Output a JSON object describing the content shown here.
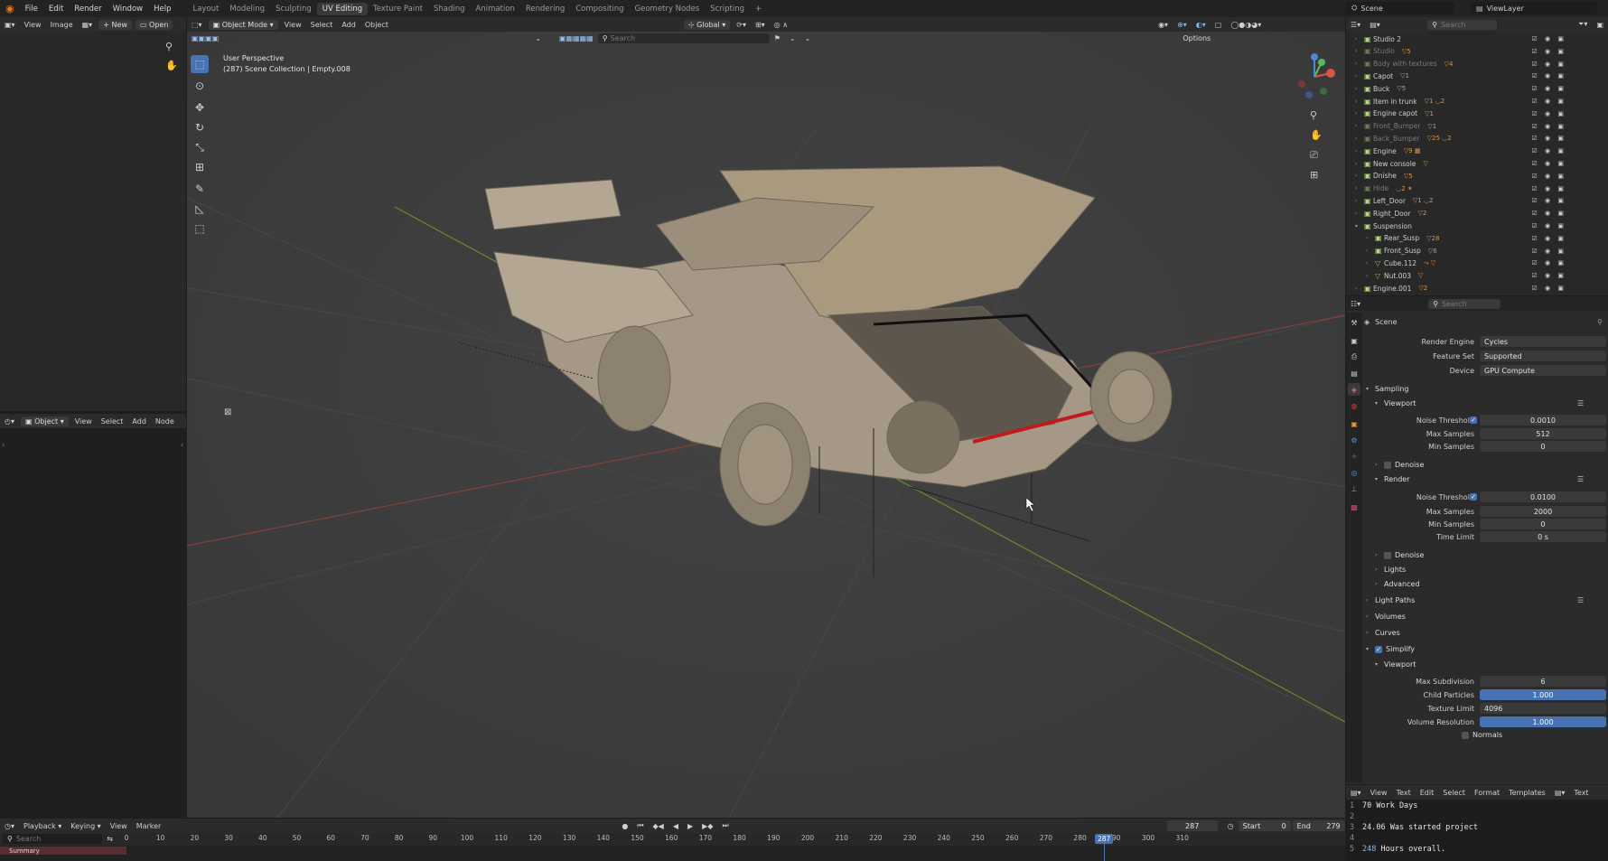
{
  "topbar": {
    "menus": [
      "File",
      "Edit",
      "Render",
      "Window",
      "Help"
    ],
    "workspaces": [
      "Layout",
      "Modeling",
      "Sculpting",
      "UV Editing",
      "Texture Paint",
      "Shading",
      "Animation",
      "Rendering",
      "Compositing",
      "Geometry Nodes",
      "Scripting"
    ],
    "active_workspace": "UV Editing",
    "scene_name": "Scene",
    "view_layer": "ViewLayer"
  },
  "image_editor": {
    "menus": [
      "View",
      "Image"
    ],
    "new_label": "New",
    "open_label": "Open"
  },
  "node_editor": {
    "mode": "Object",
    "menus": [
      "View",
      "Select",
      "Add",
      "Node"
    ]
  },
  "viewport": {
    "mode": "Object Mode",
    "menus": [
      "View",
      "Select",
      "Add",
      "Object"
    ],
    "orientation": "Global",
    "search_placeholder": "Search",
    "options_label": "Options",
    "info_line1": "User Perspective",
    "info_line2": "(287) Scene Collection | Empty.008"
  },
  "outliner": {
    "search_placeholder": "Search",
    "items": [
      {
        "name": "Studio 2",
        "badges": "",
        "muted": false,
        "indent": 0
      },
      {
        "name": "Studio",
        "badges": "▽5",
        "muted": true,
        "indent": 0
      },
      {
        "name": "Body with textures",
        "badges": "▽4",
        "muted": true,
        "indent": 0
      },
      {
        "name": "Capot",
        "badges": "▽1",
        "muted": false,
        "indent": 0
      },
      {
        "name": "Buck",
        "badges": "▽5",
        "muted": false,
        "indent": 0
      },
      {
        "name": "Item in trunk",
        "badges": "▽1 ◡2",
        "muted": false,
        "indent": 0
      },
      {
        "name": "Engine capot",
        "badges": "▽1",
        "muted": false,
        "indent": 0
      },
      {
        "name": "Front_Bumper",
        "badges": "▽1",
        "muted": true,
        "indent": 0
      },
      {
        "name": "Back_Bumper",
        "badges": "▽25 ◡2",
        "muted": true,
        "indent": 0
      },
      {
        "name": "Engine",
        "badges": "▽9 ▦",
        "muted": false,
        "indent": 0
      },
      {
        "name": "New console",
        "badges": "▽",
        "muted": false,
        "indent": 0
      },
      {
        "name": "Dnishe",
        "badges": "▽5",
        "muted": false,
        "indent": 0
      },
      {
        "name": "Hide",
        "badges": "◡2 ✶",
        "muted": true,
        "indent": 0
      },
      {
        "name": "Left_Door",
        "badges": "▽1 ◡2",
        "muted": false,
        "indent": 0
      },
      {
        "name": "Right_Door",
        "badges": "▽2",
        "muted": false,
        "indent": 0
      },
      {
        "name": "Suspension",
        "badges": "",
        "muted": false,
        "indent": 0
      },
      {
        "name": "Rear_Susp",
        "badges": "▽28",
        "muted": false,
        "indent": 1
      },
      {
        "name": "Front_Susp",
        "badges": "▽6",
        "muted": false,
        "indent": 1
      },
      {
        "name": "Cube.112",
        "badges": "⤳ ▽",
        "muted": false,
        "indent": 1
      },
      {
        "name": "Nut.003",
        "badges": "▽",
        "muted": false,
        "indent": 1
      },
      {
        "name": "Engine.001",
        "badges": "▽2",
        "muted": false,
        "indent": 0
      }
    ]
  },
  "properties": {
    "search_placeholder": "Search",
    "context": "Scene",
    "render_engine_label": "Render Engine",
    "render_engine": "Cycles",
    "feature_set_label": "Feature Set",
    "feature_set": "Supported",
    "device_label": "Device",
    "device": "GPU Compute",
    "sampling": "Sampling",
    "viewport": "Viewport",
    "noise_threshold_label": "Noise Threshold",
    "vp_noise_threshold": "0.0010",
    "max_samples_label": "Max Samples",
    "vp_max_samples": "512",
    "min_samples_label": "Min Samples",
    "vp_min_samples": "0",
    "denoise": "Denoise",
    "render": "Render",
    "r_noise_threshold": "0.0100",
    "r_max_samples": "2000",
    "r_min_samples": "0",
    "time_limit_label": "Time Limit",
    "r_time_limit": "0 s",
    "lights": "Lights",
    "advanced": "Advanced",
    "light_paths": "Light Paths",
    "volumes": "Volumes",
    "curves": "Curves",
    "simplify": "Simplify",
    "max_subdivision_label": "Max Subdivision",
    "max_subdivision": "6",
    "child_particles_label": "Child Particles",
    "child_particles": "1.000",
    "texture_limit_label": "Texture Limit",
    "texture_limit": "4096",
    "volume_resolution_label": "Volume Resolution",
    "volume_resolution": "1.000",
    "normals": "Normals"
  },
  "text_editor": {
    "menus": [
      "View",
      "Text",
      "Edit",
      "Select",
      "Format",
      "Templates"
    ],
    "text_name": "Text",
    "lines": [
      {
        "n": "1",
        "text": "70 Work Days",
        "hl": ""
      },
      {
        "n": "2",
        "text": "",
        "hl": ""
      },
      {
        "n": "3",
        "text": "24.06 Was started project",
        "hl": ""
      },
      {
        "n": "4",
        "text": "",
        "hl": ""
      },
      {
        "n": "5",
        "text": " Hours overall.",
        "hl": "248"
      }
    ]
  },
  "timeline": {
    "menus": [
      "Playback",
      "Keying",
      "View",
      "Marker"
    ],
    "current_frame": "287",
    "start_label": "Start",
    "start": "0",
    "end_label": "End",
    "end": "279",
    "search_placeholder": "Search",
    "summary": "Summary",
    "ticks": [
      "0",
      "10",
      "20",
      "30",
      "40",
      "50",
      "60",
      "70",
      "80",
      "90",
      "100",
      "110",
      "120",
      "130",
      "140",
      "150",
      "160",
      "170",
      "180",
      "190",
      "200",
      "210",
      "220",
      "230",
      "240",
      "250",
      "260",
      "270",
      "280",
      "290",
      "300",
      "310"
    ],
    "playhead_label": "287"
  }
}
